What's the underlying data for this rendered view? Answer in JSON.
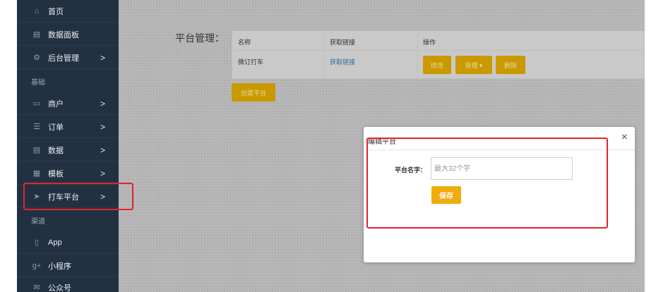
{
  "sidebar": {
    "items": [
      {
        "label": "首页",
        "icon": "home-icon",
        "glyph": "⌂"
      },
      {
        "label": "数据面板",
        "icon": "chart-icon",
        "glyph": "▤"
      },
      {
        "label": "后台管理",
        "icon": "cogs-icon",
        "glyph": "⚙",
        "chevron": ">"
      },
      {
        "label": "商户",
        "icon": "laptop-icon",
        "glyph": "▭",
        "chevron": ">"
      },
      {
        "label": "订单",
        "icon": "list-icon",
        "glyph": "☰",
        "chevron": ">"
      },
      {
        "label": "数据",
        "icon": "chart-icon",
        "glyph": "▤",
        "chevron": ">"
      },
      {
        "label": "模板",
        "icon": "grid-icon",
        "glyph": "▦",
        "chevron": ">"
      },
      {
        "label": "打车平台",
        "icon": "location-arrow-icon",
        "glyph": "➤",
        "chevron": ">"
      },
      {
        "label": "App",
        "icon": "mobile-icon",
        "glyph": "▯"
      },
      {
        "label": "小程序",
        "icon": "google-plus-icon",
        "glyph": "g+"
      },
      {
        "label": "公众号",
        "icon": "wechat-icon",
        "glyph": "✉"
      }
    ],
    "sections": [
      "基础",
      "渠道"
    ]
  },
  "main": {
    "title": "平台管理：",
    "table": {
      "headers": [
        "名称",
        "获取链接",
        "操作"
      ],
      "row": {
        "name": "微订打车",
        "link": "获取链接"
      },
      "actions": [
        "修改",
        "管理 ▾",
        "删除"
      ]
    },
    "create_label": "创建平台"
  },
  "modal": {
    "title": "编辑平台",
    "close": "×",
    "field_label": "平台名字：",
    "placeholder": "最大32个字",
    "save_label": "保存"
  },
  "colors": {
    "sidebar_bg": "#223142",
    "accent_button": "#f0ab0c",
    "highlight_red": "#e3232c"
  }
}
